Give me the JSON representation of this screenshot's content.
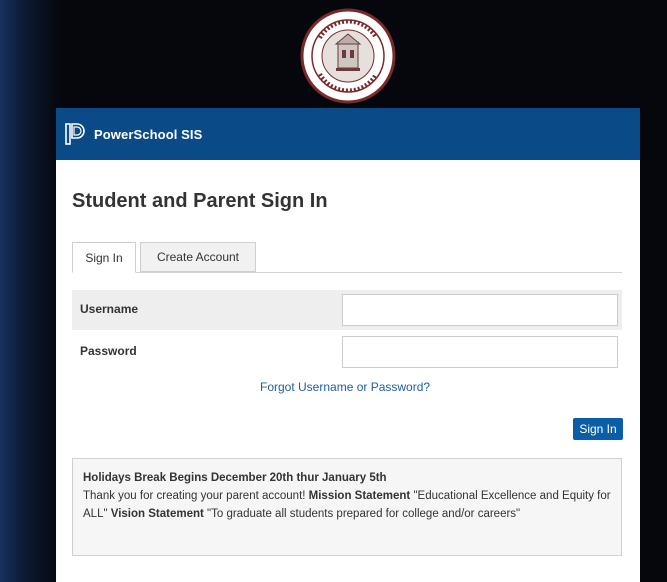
{
  "seal": {
    "icon": "county-schools-seal-icon",
    "ring_color": "#7a2a2a"
  },
  "header": {
    "brand": "PowerSchool SIS",
    "logo_icon": "powerschool-logo-icon",
    "color": "#0a4a87"
  },
  "page": {
    "title": "Student and Parent Sign In"
  },
  "tabs": [
    {
      "label": "Sign In",
      "active": true
    },
    {
      "label": "Create Account",
      "active": false
    }
  ],
  "form": {
    "username_label": "Username",
    "username_value": "",
    "password_label": "Password",
    "password_value": ""
  },
  "forgot_link": "Forgot Username or Password?",
  "signin_button": "Sign In",
  "notice": {
    "headline": "Holidays Break Begins December 20th thur January 5th",
    "intro": "Thank you for creating your parent account! ",
    "mission_label": "Mission Statement",
    "mission_text": " \"Educational Excellence and Equity for ALL\" ",
    "vision_label": "Vision Statement",
    "vision_text": " \"To graduate all students prepared for college and/or careers\""
  }
}
